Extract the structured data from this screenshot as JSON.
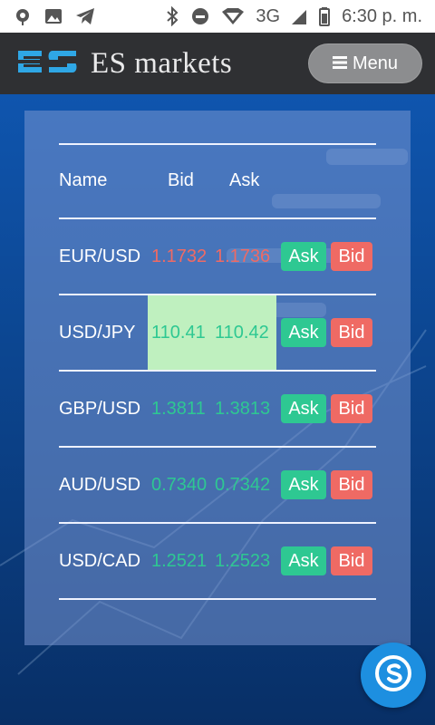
{
  "status_bar": {
    "network": "3G",
    "time": "6:30 p. m."
  },
  "header": {
    "brand_name": "ES markets",
    "menu_label": "Menu"
  },
  "table": {
    "headers": {
      "name": "Name",
      "bid": "Bid",
      "ask": "Ask"
    },
    "rows": [
      {
        "name": "EUR/USD",
        "bid": "1.1732",
        "ask": "1.1736",
        "ask_btn": "Ask",
        "bid_btn": "Bid",
        "price_color": "#ef6a64",
        "highlight": false
      },
      {
        "name": "USD/JPY",
        "bid": "110.41",
        "ask": "110.42",
        "ask_btn": "Ask",
        "bid_btn": "Bid",
        "price_color": "#2ec892",
        "highlight": true
      },
      {
        "name": "GBP/USD",
        "bid": "1.3811",
        "ask": "1.3813",
        "ask_btn": "Ask",
        "bid_btn": "Bid",
        "price_color": "#2ec892",
        "highlight": false
      },
      {
        "name": "AUD/USD",
        "bid": "0.7340",
        "ask": "0.7342",
        "ask_btn": "Ask",
        "bid_btn": "Bid",
        "price_color": "#2ec892",
        "highlight": false
      },
      {
        "name": "USD/CAD",
        "bid": "1.2521",
        "ask": "1.2523",
        "ask_btn": "Ask",
        "bid_btn": "Bid",
        "price_color": "#2ec892",
        "highlight": false
      }
    ]
  },
  "colors": {
    "header_bg": "#2f3033",
    "ask_button": "#2ec892",
    "bid_button": "#ef6a64",
    "row_highlight": "#bff0bf",
    "skype_blue": "#1d8fe0"
  },
  "icons": {
    "status_left": [
      "location-icon",
      "image-icon",
      "telegram-icon"
    ],
    "status_right": [
      "bluetooth-icon",
      "do-not-disturb-icon",
      "wifi-icon",
      "signal-icon",
      "battery-icon"
    ],
    "header": "menu-icon",
    "fab": "skype-icon"
  }
}
